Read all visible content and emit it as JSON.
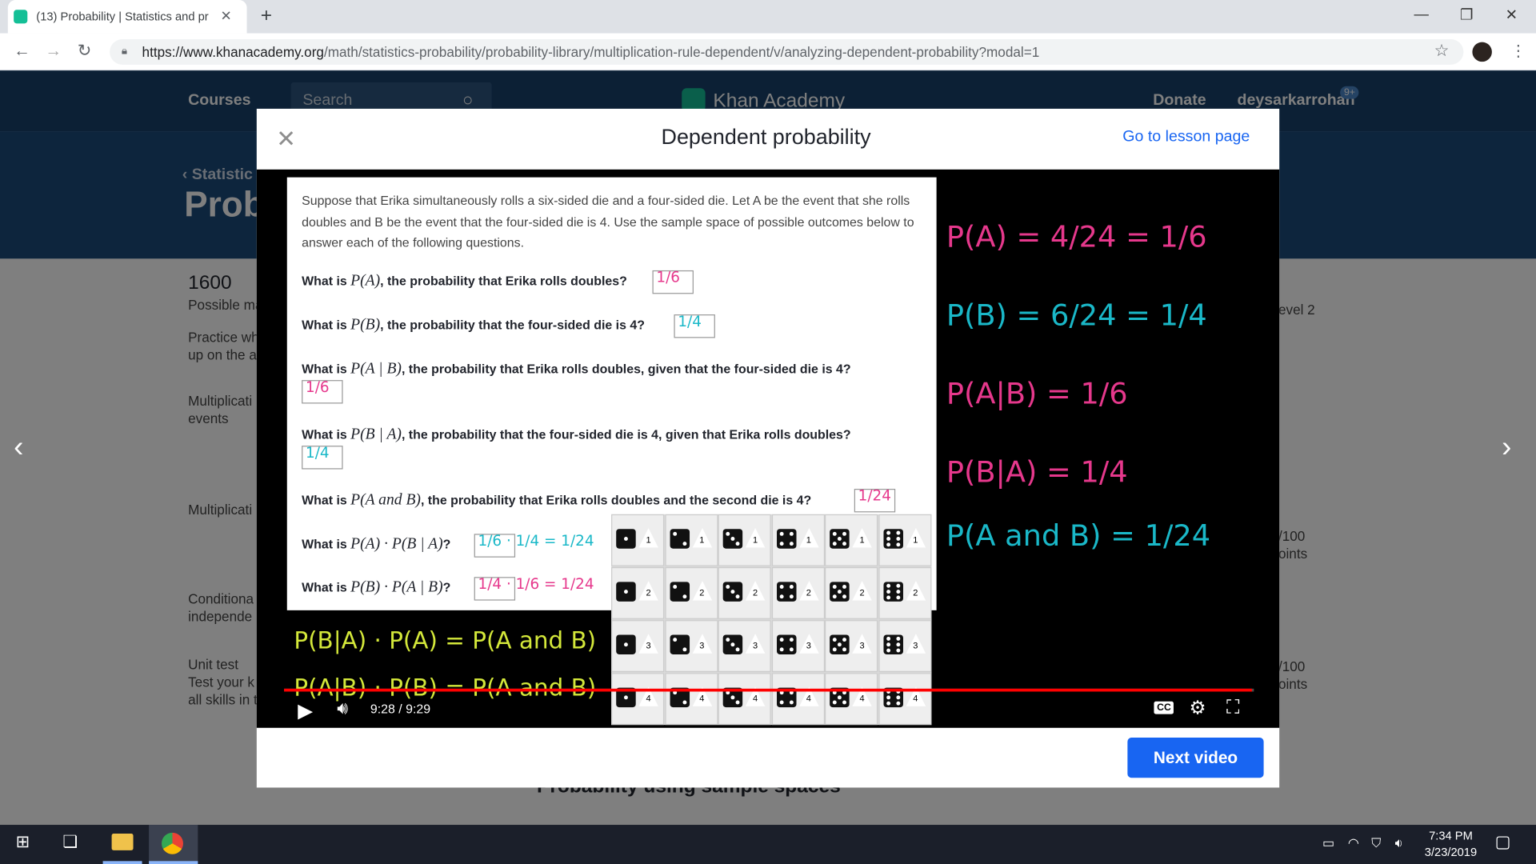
{
  "browser": {
    "tab_title": "(13) Probability | Statistics and pr",
    "url_host": "https://www.khanacademy.org",
    "url_path": "/math/statistics-probability/probability-library/multiplication-rule-dependent/v/analyzing-dependent-probability?modal=1"
  },
  "site_nav": {
    "courses": "Courses",
    "search": "Search",
    "logo": "Khan Academy",
    "donate": "Donate",
    "username": "deysarkarrohan",
    "notification_badge": "9+"
  },
  "background_page": {
    "breadcrumb": "Statistic",
    "title": "Prob",
    "mastery_points": "1600",
    "possible_label": "Possible ma",
    "practice": "Practice wh",
    "practice2": "up on the a",
    "item1": "Multiplicati",
    "item1b": "events",
    "item2": "Multiplicati",
    "item3": "Conditiona",
    "item3b": "independe",
    "unit_test": "Unit test",
    "unit_test_desc": "Test your k",
    "unit_test_desc2": "all skills in t",
    "level_label": "evel 2",
    "pts1": "/100",
    "pts1b": "oints",
    "pts2": "/100",
    "pts2b": "oints",
    "bottom_title": "Probability using sample spaces"
  },
  "modal": {
    "title": "Dependent probability",
    "lesson_link": "Go to lesson page",
    "next_button": "Next video"
  },
  "slide": {
    "intro": "Suppose that Erika simultaneously rolls a six-sided die and a four-sided die. Let A be the event that she rolls doubles and B be the event that the four-sided die is 4. Use the sample space of possible outcomes below to answer each of the following questions.",
    "questions": [
      {
        "pre": "What is ",
        "math": "P(A)",
        "post": ", the probability that Erika rolls doubles?",
        "answer": "1/6"
      },
      {
        "pre": "What is ",
        "math": "P(B)",
        "post": ", the probability that the four-sided die is 4?",
        "answer": "1/4"
      },
      {
        "pre": "What is ",
        "math": "P(A | B)",
        "post": ", the probability that Erika rolls doubles, given that the four-sided die is 4?",
        "answer": "1/6"
      },
      {
        "pre": "What is ",
        "math": "P(B | A)",
        "post": ", the probability that the four-sided die is 4, given that Erika rolls doubles?",
        "answer": "1/4"
      },
      {
        "pre": "What is ",
        "math": "P(A and B)",
        "post": ", the probability that Erika rolls doubles and the second die is 4?",
        "answer": "1/24"
      },
      {
        "pre": "What is ",
        "math": "P(A) · P(B | A)",
        "post": "?",
        "answer": "1/6 · 1/4 = 1/24"
      },
      {
        "pre": "What is ",
        "math": "P(B) · P(A | B)",
        "post": "?",
        "answer": "1/4 · 1/6 = 1/24"
      }
    ],
    "chalk_right": [
      "P(A) = 4/24 = 1/6",
      "P(B) = 6/24 = 1/4",
      "P(A|B) = 1/6",
      "P(B|A) = 1/4",
      "P(A and B) = 1/24"
    ],
    "chalk_bottom": [
      "P(B|A) · P(A) = P(A and B)",
      "P(A|B) · P(B) = P(A and B)"
    ],
    "dice_rows": [
      "1",
      "2",
      "3",
      "4"
    ],
    "dice_cols": [
      1,
      2,
      3,
      4,
      5,
      6
    ]
  },
  "player": {
    "time": "9:28 / 9:29",
    "progress": 0.998,
    "cc_label": "CC"
  },
  "taskbar": {
    "time": "7:34 PM",
    "date": "3/23/2019"
  },
  "colors": {
    "accent": "#1865f2",
    "ka_nav": "#18406b",
    "chalk_pink": "#e6388c",
    "chalk_teal": "#1ab8c8",
    "chalk_yellow": "#d4e83a",
    "progress_red": "#ff0000"
  }
}
